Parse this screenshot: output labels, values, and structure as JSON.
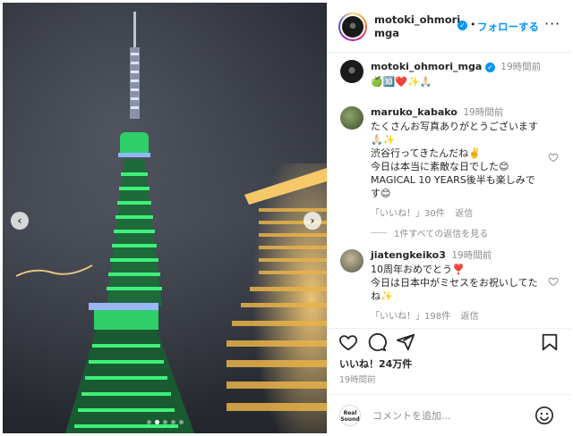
{
  "photo": {
    "prev_arrow": "‹",
    "next_arrow": "›",
    "slide_count": 5,
    "active_slide": 2
  },
  "header": {
    "username": "motoki_ohmori_mga",
    "verified": "✓",
    "dot": "•",
    "follow_label": "フォローする",
    "more_label": "···"
  },
  "caption": {
    "username": "motoki_ohmori_mga",
    "time": "19時間前",
    "text": "🍏🔟❤️✨🙏🏻"
  },
  "comments": [
    {
      "username": "maruko_kabako",
      "time": "19時間前",
      "lines": [
        "たくさんお写真ありがとうございます",
        "🙏🏻✨",
        "渋谷行ってきたんだね✌️",
        "今日は本当に素敵な日でした😊",
        "MAGICAL 10 YEARS後半も楽しみで",
        "す😊"
      ],
      "likes": "「いいね！」30件",
      "reply": "返信",
      "view_replies": "1件すべての返信を見る"
    },
    {
      "username": "jiatengkeiko3",
      "time": "19時間前",
      "lines": [
        "10周年おめでとう❣️",
        "今日は日本中がミセスをお祝いしてた",
        "ね✨"
      ],
      "likes": "「いいね！」198件",
      "reply": "返信"
    }
  ],
  "actions": {
    "like_icon": "heart-icon",
    "comment_icon": "comment-icon",
    "share_icon": "share-icon",
    "save_icon": "bookmark-icon"
  },
  "likes_count": "いいね！24万件",
  "post_time": "19時間前",
  "comment_box": {
    "logo_text": "Real Sound",
    "placeholder": "コメントを追加..."
  }
}
